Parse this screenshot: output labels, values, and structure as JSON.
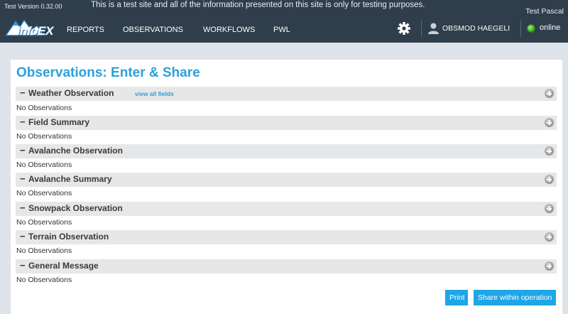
{
  "header": {
    "version": "Test Version 0.32.00",
    "notice": "This is a test site and all of the information presented on this site is only for testing purposes.",
    "site_user": "Test Pascal",
    "logo_text": "infoEX",
    "nav": [
      "REPORTS",
      "OBSERVATIONS",
      "WORKFLOWS",
      "PWL"
    ],
    "user_name": "OBSMOD HAEGELI",
    "status": "online",
    "icons": {
      "settings": "gear-icon",
      "user": "user-icon",
      "status": "status-dot-icon"
    },
    "status_color": "#3aa21d"
  },
  "main": {
    "title": "Observations: Enter & Share",
    "view_all_label": "view all fields",
    "sections": [
      {
        "title": "Weather Observation",
        "empty": "No Observations"
      },
      {
        "title": "Field Summary",
        "empty": "No Observations"
      },
      {
        "title": "Avalanche Observation",
        "empty": "No Observations"
      },
      {
        "title": "Avalanche Summary",
        "empty": "No Observations"
      },
      {
        "title": "Snowpack Observation",
        "empty": "No Observations"
      },
      {
        "title": "Terrain Observation",
        "empty": "No Observations"
      },
      {
        "title": "General Message",
        "empty": "No Observations"
      }
    ],
    "collapse_symbol": "−",
    "buttons": {
      "print": "Print",
      "share": "Share within operation"
    }
  },
  "colors": {
    "accent": "#2ba1da",
    "button": "#1ea6e6",
    "topbar": "#2f3e4a"
  }
}
